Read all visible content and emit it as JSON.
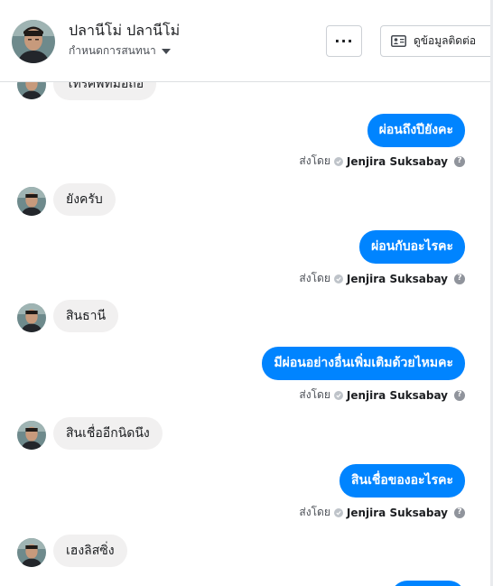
{
  "header": {
    "name": "ปลานีโม่ ปลานีโม่",
    "subtitle": "กำหนดการสนทนา",
    "more_label": "···",
    "contact_label": "ดูข้อมูลติดต่อ"
  },
  "thread": {
    "top_partial_text": "โทรศัพท์มือถือ",
    "sent_by_prefix": "ส่งโดย",
    "agent_name": "Jenjira Suksabay",
    "help_label": "?",
    "messages": [
      {
        "from": "page",
        "text": "ผ่อนถึงปียังคะ"
      },
      {
        "from": "customer",
        "text": "ยังครับ"
      },
      {
        "from": "page",
        "text": "ผ่อนกับอะไรคะ"
      },
      {
        "from": "customer",
        "text": "สินธานี"
      },
      {
        "from": "page",
        "text": "มีผ่อนอย่างอื่นเพิ่มเติมด้วยไหมคะ"
      },
      {
        "from": "customer",
        "text": "สินเชื่ออีกนิดนึง"
      },
      {
        "from": "page",
        "text": "สินเชื่อของอะไรคะ"
      },
      {
        "from": "customer",
        "text": "เฮงลิสซิ่ง"
      }
    ]
  }
}
